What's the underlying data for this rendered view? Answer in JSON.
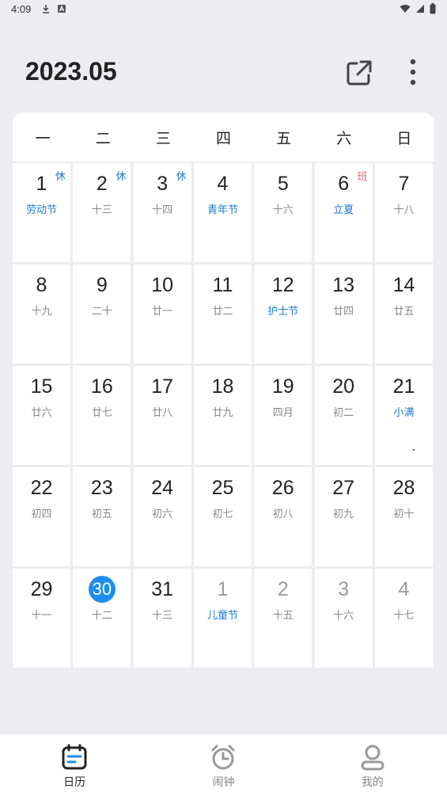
{
  "status_bar": {
    "time": "4:09"
  },
  "header": {
    "title": "2023.05"
  },
  "weekdays": [
    "一",
    "二",
    "三",
    "四",
    "五",
    "六",
    "日"
  ],
  "days": [
    {
      "day": "1",
      "lunar": "劳动节",
      "badge": "休"
    },
    {
      "day": "2",
      "lunar": "十三",
      "badge": "休"
    },
    {
      "day": "3",
      "lunar": "十四",
      "badge": "休"
    },
    {
      "day": "4",
      "lunar": "青年节",
      "badge": ""
    },
    {
      "day": "5",
      "lunar": "十六",
      "badge": ""
    },
    {
      "day": "6",
      "lunar": "立夏",
      "badge": "班"
    },
    {
      "day": "7",
      "lunar": "十八",
      "badge": ""
    },
    {
      "day": "8",
      "lunar": "十九",
      "badge": ""
    },
    {
      "day": "9",
      "lunar": "二十",
      "badge": ""
    },
    {
      "day": "10",
      "lunar": "廿一",
      "badge": ""
    },
    {
      "day": "11",
      "lunar": "廿二",
      "badge": ""
    },
    {
      "day": "12",
      "lunar": "护士节",
      "badge": ""
    },
    {
      "day": "13",
      "lunar": "廿四",
      "badge": ""
    },
    {
      "day": "14",
      "lunar": "廿五",
      "badge": ""
    },
    {
      "day": "15",
      "lunar": "廿六",
      "badge": ""
    },
    {
      "day": "16",
      "lunar": "廿七",
      "badge": ""
    },
    {
      "day": "17",
      "lunar": "廿八",
      "badge": ""
    },
    {
      "day": "18",
      "lunar": "廿九",
      "badge": ""
    },
    {
      "day": "19",
      "lunar": "四月",
      "badge": ""
    },
    {
      "day": "20",
      "lunar": "初二",
      "badge": ""
    },
    {
      "day": "21",
      "lunar": "小满",
      "badge": ""
    },
    {
      "day": "22",
      "lunar": "初四",
      "badge": ""
    },
    {
      "day": "23",
      "lunar": "初五",
      "badge": ""
    },
    {
      "day": "24",
      "lunar": "初六",
      "badge": ""
    },
    {
      "day": "25",
      "lunar": "初七",
      "badge": ""
    },
    {
      "day": "26",
      "lunar": "初八",
      "badge": ""
    },
    {
      "day": "27",
      "lunar": "初九",
      "badge": ""
    },
    {
      "day": "28",
      "lunar": "初十",
      "badge": ""
    },
    {
      "day": "29",
      "lunar": "十一",
      "badge": ""
    },
    {
      "day": "30",
      "lunar": "十二",
      "badge": ""
    },
    {
      "day": "31",
      "lunar": "十三",
      "badge": ""
    },
    {
      "day": "1",
      "lunar": "儿童节",
      "badge": ""
    },
    {
      "day": "2",
      "lunar": "十五",
      "badge": ""
    },
    {
      "day": "3",
      "lunar": "十六",
      "badge": ""
    },
    {
      "day": "4",
      "lunar": "十七",
      "badge": ""
    }
  ],
  "nav": [
    {
      "label": "日历",
      "icon": "calendar-icon"
    },
    {
      "label": "闹钟",
      "icon": "alarm-clock-icon"
    },
    {
      "label": "我的",
      "icon": "profile-icon"
    }
  ],
  "colors": {
    "accent": "#1e8cf0",
    "holiday": "#1a7bd1",
    "workday": "#e8677a"
  }
}
